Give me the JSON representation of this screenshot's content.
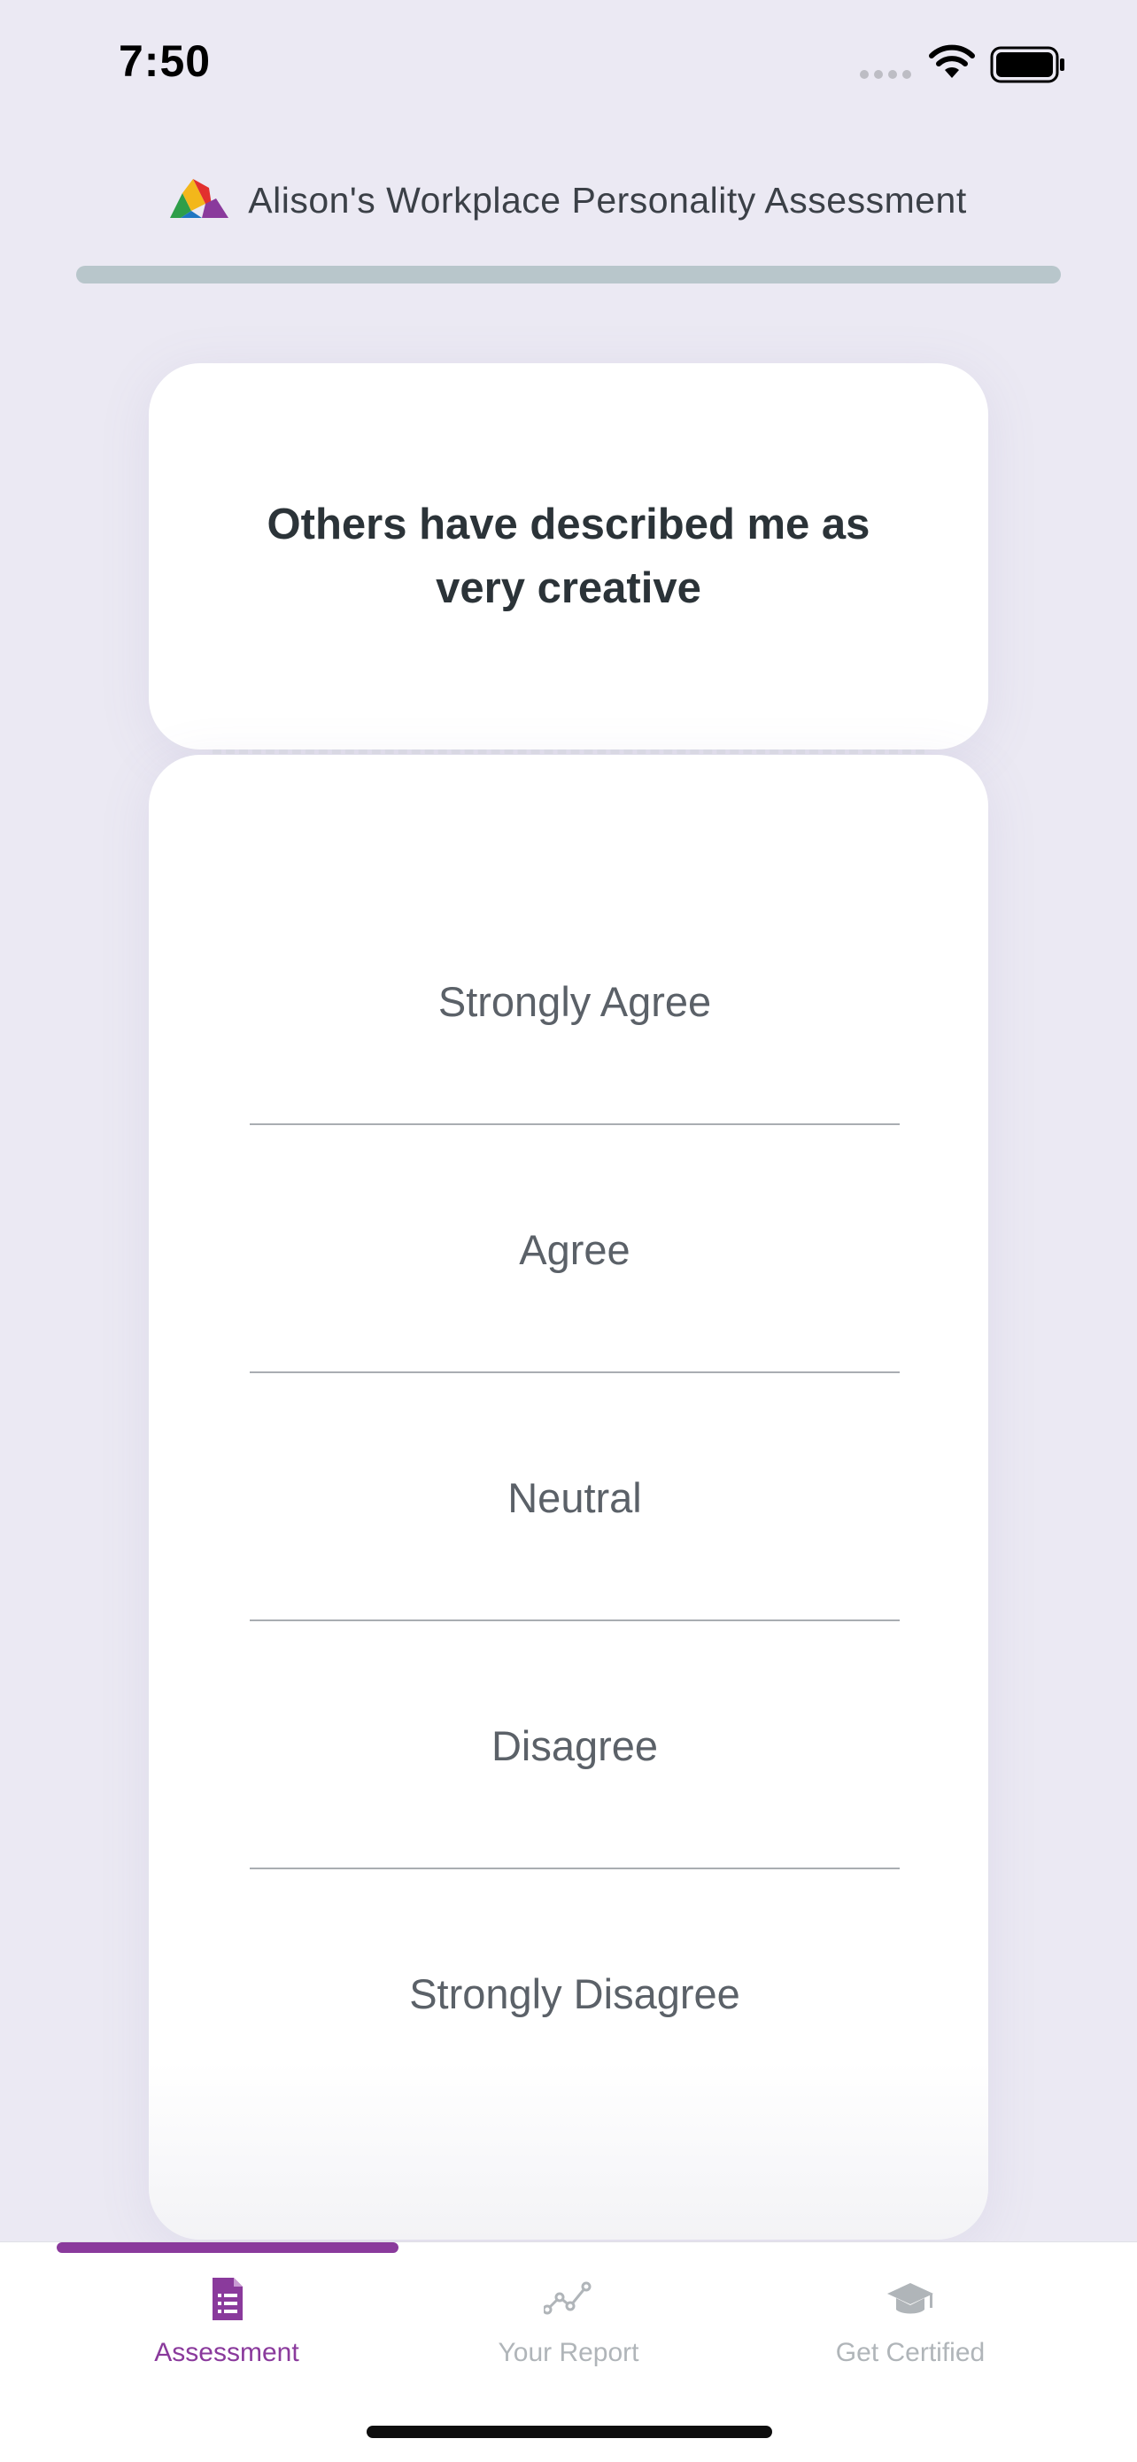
{
  "status_bar": {
    "time": "7:50"
  },
  "header": {
    "title": "Alison's Workplace Personality Assessment",
    "progress_percent": 0,
    "colors": {
      "accent": "#8a3a9c",
      "track": "#b8c6cb"
    }
  },
  "question": {
    "text": "Others have described me as very creative"
  },
  "answers": [
    {
      "label": "Strongly Agree"
    },
    {
      "label": "Agree"
    },
    {
      "label": "Neutral"
    },
    {
      "label": "Disagree"
    },
    {
      "label": "Strongly Disagree"
    }
  ],
  "bottom_nav": {
    "items": [
      {
        "label": "Assessment",
        "icon": "assessment-form-icon",
        "active": true
      },
      {
        "label": "Your Report",
        "icon": "report-chart-icon",
        "active": false
      },
      {
        "label": "Get Certified",
        "icon": "graduation-cap-icon",
        "active": false
      }
    ]
  }
}
